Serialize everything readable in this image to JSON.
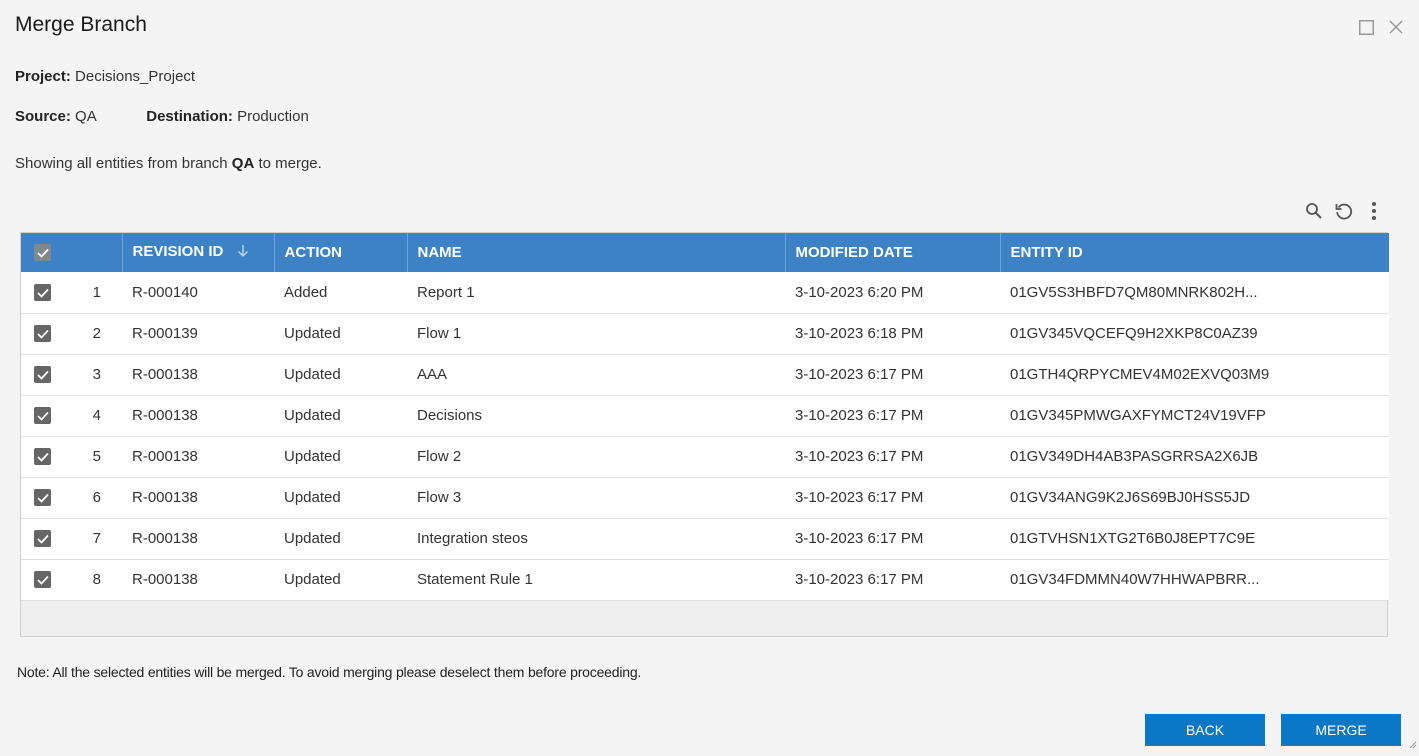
{
  "dialog": {
    "title": "Merge Branch"
  },
  "project": {
    "label": "Project:",
    "value": "Decisions_Project"
  },
  "source": {
    "label": "Source:",
    "value": "QA"
  },
  "destination": {
    "label": "Destination:",
    "value": "Production"
  },
  "showing": {
    "prefix": "Showing all entities from branch ",
    "branch": "QA",
    "suffix": " to merge."
  },
  "toolbar": {
    "search_icon": "search-icon",
    "refresh_icon": "refresh-icon",
    "more_icon": "more-vertical-icon"
  },
  "table": {
    "columns": [
      "REVISION ID",
      "ACTION",
      "NAME",
      "MODIFIED DATE",
      "ENTITY ID"
    ],
    "rows": [
      {
        "num": "1",
        "revision": "R-000140",
        "action": "Added",
        "name": "Report 1",
        "modified": "3-10-2023 6:20 PM",
        "entity": "01GV5S3HBFD7QM80MNRK802H..."
      },
      {
        "num": "2",
        "revision": "R-000139",
        "action": "Updated",
        "name": "Flow 1",
        "modified": "3-10-2023 6:18 PM",
        "entity": "01GV345VQCEFQ9H2XKP8C0AZ39"
      },
      {
        "num": "3",
        "revision": "R-000138",
        "action": "Updated",
        "name": "AAA",
        "modified": "3-10-2023 6:17 PM",
        "entity": "01GTH4QRPYCMEV4M02EXVQ03M9"
      },
      {
        "num": "4",
        "revision": "R-000138",
        "action": "Updated",
        "name": "Decisions",
        "modified": "3-10-2023 6:17 PM",
        "entity": "01GV345PMWGAXFYMCT24V19VFP"
      },
      {
        "num": "5",
        "revision": "R-000138",
        "action": "Updated",
        "name": "Flow 2",
        "modified": "3-10-2023 6:17 PM",
        "entity": "01GV349DH4AB3PASGRRSA2X6JB"
      },
      {
        "num": "6",
        "revision": "R-000138",
        "action": "Updated",
        "name": "Flow 3",
        "modified": "3-10-2023 6:17 PM",
        "entity": "01GV34ANG9K2J6S69BJ0HSS5JD"
      },
      {
        "num": "7",
        "revision": "R-000138",
        "action": "Updated",
        "name": "Integration steos",
        "modified": "3-10-2023 6:17 PM",
        "entity": "01GTVHSN1XTG2T6B0J8EPT7C9E"
      },
      {
        "num": "8",
        "revision": "R-000138",
        "action": "Updated",
        "name": "Statement Rule 1",
        "modified": "3-10-2023 6:17 PM",
        "entity": "01GV34FDMMN40W7HHWAPBRR..."
      }
    ]
  },
  "note": "Note: All the selected entities will be merged. To avoid merging please deselect them before proceeding.",
  "buttons": {
    "back": "BACK",
    "merge": "MERGE"
  },
  "colors": {
    "header_bg": "#3c82c4",
    "button_bg": "#0a78c4",
    "checkbox": "#666666"
  }
}
